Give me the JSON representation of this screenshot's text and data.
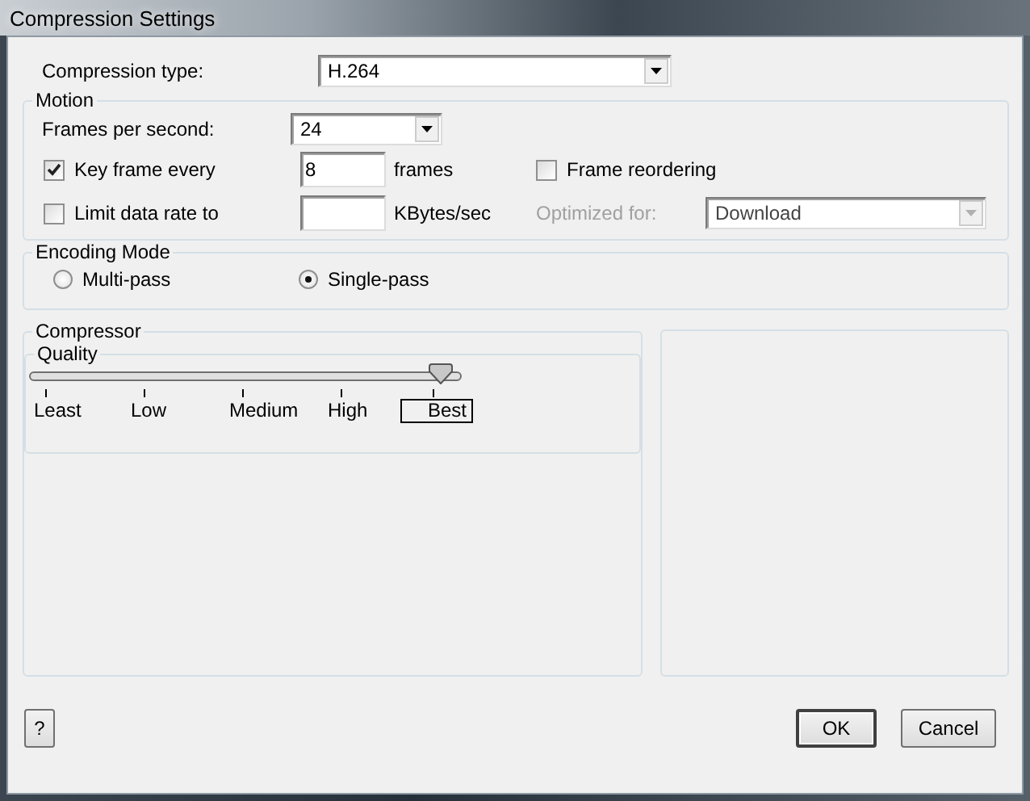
{
  "window": {
    "title": "Compression Settings"
  },
  "compression_type": {
    "label": "Compression type:",
    "value": "H.264"
  },
  "motion": {
    "title": "Motion",
    "frames_per_second": {
      "label": "Frames per second:",
      "value": "24"
    },
    "key_frame": {
      "label": "Key frame every",
      "checked": true,
      "value": "8",
      "unit": "frames"
    },
    "frame_reordering": {
      "label": "Frame reordering",
      "checked": false
    },
    "limit_data_rate": {
      "label": "Limit data rate to",
      "checked": false,
      "unit": "KBytes/sec"
    },
    "optimized_for": {
      "label": "Optimized for:",
      "value": "Download",
      "disabled": true
    }
  },
  "encoding_mode": {
    "title": "Encoding Mode",
    "options": [
      {
        "label": "Multi-pass",
        "selected": false
      },
      {
        "label": "Single-pass",
        "selected": true
      }
    ]
  },
  "compressor": {
    "title": "Compressor",
    "quality": {
      "title": "Quality",
      "level": 1,
      "ticks": [
        {
          "label": "Least",
          "selected": false
        },
        {
          "label": "Low",
          "selected": false
        },
        {
          "label": "Medium",
          "selected": false
        },
        {
          "label": "High",
          "selected": false
        },
        {
          "label": "Best",
          "selected": true
        }
      ]
    }
  },
  "buttons": [
    {
      "kind": "help",
      "label": "?"
    },
    {
      "kind": "default",
      "label": "OK"
    },
    {
      "kind": "normal",
      "label": "Cancel"
    }
  ]
}
